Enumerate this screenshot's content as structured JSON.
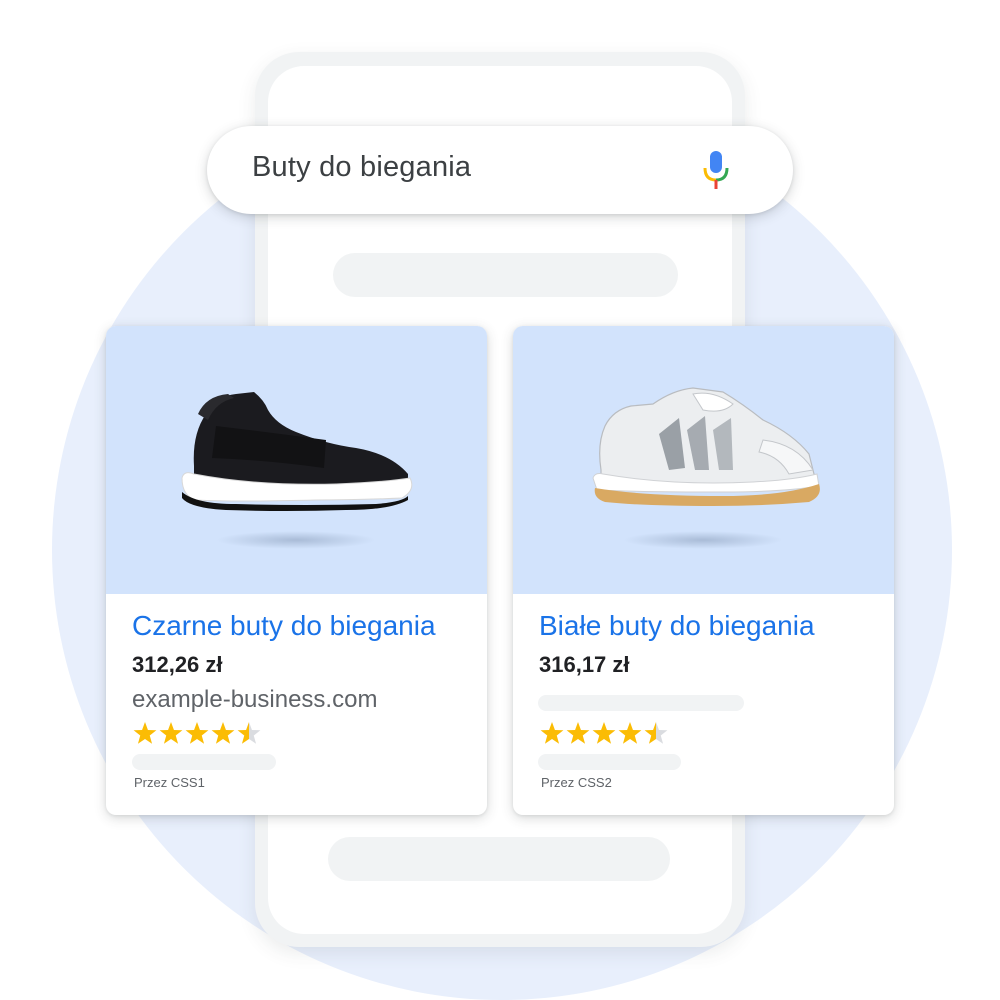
{
  "search": {
    "query": "Buty do biegania"
  },
  "icons": {
    "mic": "microphone-icon"
  },
  "colors": {
    "title_link": "#1a73e8",
    "card_image_bg": "#d2e3fc",
    "background_circle": "#e8effc",
    "star": "#fbbc04"
  },
  "results": [
    {
      "title": "Czarne buty do biegania",
      "price": "312,26 zł",
      "domain": "example-business.com",
      "rating": 4.5,
      "via": "Przez CSS1"
    },
    {
      "title": "Białe buty do biegania",
      "price": "316,17 zł",
      "rating": 4.5,
      "via": "Przez CSS2"
    }
  ]
}
